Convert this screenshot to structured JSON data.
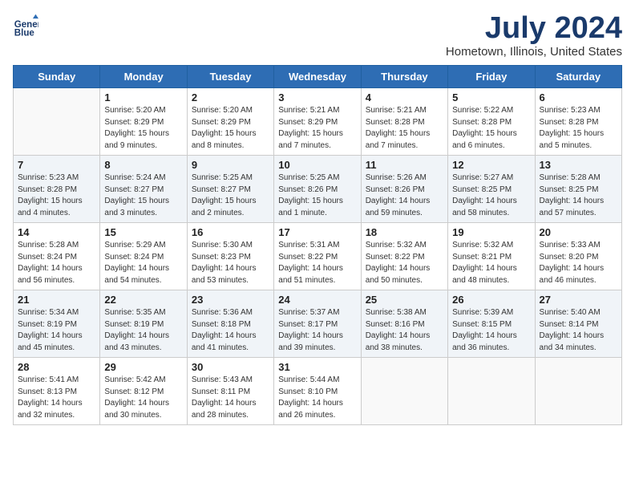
{
  "header": {
    "logo_line1": "General",
    "logo_line2": "Blue",
    "main_title": "July 2024",
    "subtitle": "Hometown, Illinois, United States"
  },
  "days_of_week": [
    "Sunday",
    "Monday",
    "Tuesday",
    "Wednesday",
    "Thursday",
    "Friday",
    "Saturday"
  ],
  "weeks": [
    {
      "shaded": false,
      "days": [
        {
          "number": "",
          "info": ""
        },
        {
          "number": "1",
          "info": "Sunrise: 5:20 AM\nSunset: 8:29 PM\nDaylight: 15 hours\nand 9 minutes."
        },
        {
          "number": "2",
          "info": "Sunrise: 5:20 AM\nSunset: 8:29 PM\nDaylight: 15 hours\nand 8 minutes."
        },
        {
          "number": "3",
          "info": "Sunrise: 5:21 AM\nSunset: 8:29 PM\nDaylight: 15 hours\nand 7 minutes."
        },
        {
          "number": "4",
          "info": "Sunrise: 5:21 AM\nSunset: 8:28 PM\nDaylight: 15 hours\nand 7 minutes."
        },
        {
          "number": "5",
          "info": "Sunrise: 5:22 AM\nSunset: 8:28 PM\nDaylight: 15 hours\nand 6 minutes."
        },
        {
          "number": "6",
          "info": "Sunrise: 5:23 AM\nSunset: 8:28 PM\nDaylight: 15 hours\nand 5 minutes."
        }
      ]
    },
    {
      "shaded": true,
      "days": [
        {
          "number": "7",
          "info": "Sunrise: 5:23 AM\nSunset: 8:28 PM\nDaylight: 15 hours\nand 4 minutes."
        },
        {
          "number": "8",
          "info": "Sunrise: 5:24 AM\nSunset: 8:27 PM\nDaylight: 15 hours\nand 3 minutes."
        },
        {
          "number": "9",
          "info": "Sunrise: 5:25 AM\nSunset: 8:27 PM\nDaylight: 15 hours\nand 2 minutes."
        },
        {
          "number": "10",
          "info": "Sunrise: 5:25 AM\nSunset: 8:26 PM\nDaylight: 15 hours\nand 1 minute."
        },
        {
          "number": "11",
          "info": "Sunrise: 5:26 AM\nSunset: 8:26 PM\nDaylight: 14 hours\nand 59 minutes."
        },
        {
          "number": "12",
          "info": "Sunrise: 5:27 AM\nSunset: 8:25 PM\nDaylight: 14 hours\nand 58 minutes."
        },
        {
          "number": "13",
          "info": "Sunrise: 5:28 AM\nSunset: 8:25 PM\nDaylight: 14 hours\nand 57 minutes."
        }
      ]
    },
    {
      "shaded": false,
      "days": [
        {
          "number": "14",
          "info": "Sunrise: 5:28 AM\nSunset: 8:24 PM\nDaylight: 14 hours\nand 56 minutes."
        },
        {
          "number": "15",
          "info": "Sunrise: 5:29 AM\nSunset: 8:24 PM\nDaylight: 14 hours\nand 54 minutes."
        },
        {
          "number": "16",
          "info": "Sunrise: 5:30 AM\nSunset: 8:23 PM\nDaylight: 14 hours\nand 53 minutes."
        },
        {
          "number": "17",
          "info": "Sunrise: 5:31 AM\nSunset: 8:22 PM\nDaylight: 14 hours\nand 51 minutes."
        },
        {
          "number": "18",
          "info": "Sunrise: 5:32 AM\nSunset: 8:22 PM\nDaylight: 14 hours\nand 50 minutes."
        },
        {
          "number": "19",
          "info": "Sunrise: 5:32 AM\nSunset: 8:21 PM\nDaylight: 14 hours\nand 48 minutes."
        },
        {
          "number": "20",
          "info": "Sunrise: 5:33 AM\nSunset: 8:20 PM\nDaylight: 14 hours\nand 46 minutes."
        }
      ]
    },
    {
      "shaded": true,
      "days": [
        {
          "number": "21",
          "info": "Sunrise: 5:34 AM\nSunset: 8:19 PM\nDaylight: 14 hours\nand 45 minutes."
        },
        {
          "number": "22",
          "info": "Sunrise: 5:35 AM\nSunset: 8:19 PM\nDaylight: 14 hours\nand 43 minutes."
        },
        {
          "number": "23",
          "info": "Sunrise: 5:36 AM\nSunset: 8:18 PM\nDaylight: 14 hours\nand 41 minutes."
        },
        {
          "number": "24",
          "info": "Sunrise: 5:37 AM\nSunset: 8:17 PM\nDaylight: 14 hours\nand 39 minutes."
        },
        {
          "number": "25",
          "info": "Sunrise: 5:38 AM\nSunset: 8:16 PM\nDaylight: 14 hours\nand 38 minutes."
        },
        {
          "number": "26",
          "info": "Sunrise: 5:39 AM\nSunset: 8:15 PM\nDaylight: 14 hours\nand 36 minutes."
        },
        {
          "number": "27",
          "info": "Sunrise: 5:40 AM\nSunset: 8:14 PM\nDaylight: 14 hours\nand 34 minutes."
        }
      ]
    },
    {
      "shaded": false,
      "days": [
        {
          "number": "28",
          "info": "Sunrise: 5:41 AM\nSunset: 8:13 PM\nDaylight: 14 hours\nand 32 minutes."
        },
        {
          "number": "29",
          "info": "Sunrise: 5:42 AM\nSunset: 8:12 PM\nDaylight: 14 hours\nand 30 minutes."
        },
        {
          "number": "30",
          "info": "Sunrise: 5:43 AM\nSunset: 8:11 PM\nDaylight: 14 hours\nand 28 minutes."
        },
        {
          "number": "31",
          "info": "Sunrise: 5:44 AM\nSunset: 8:10 PM\nDaylight: 14 hours\nand 26 minutes."
        },
        {
          "number": "",
          "info": ""
        },
        {
          "number": "",
          "info": ""
        },
        {
          "number": "",
          "info": ""
        }
      ]
    }
  ]
}
